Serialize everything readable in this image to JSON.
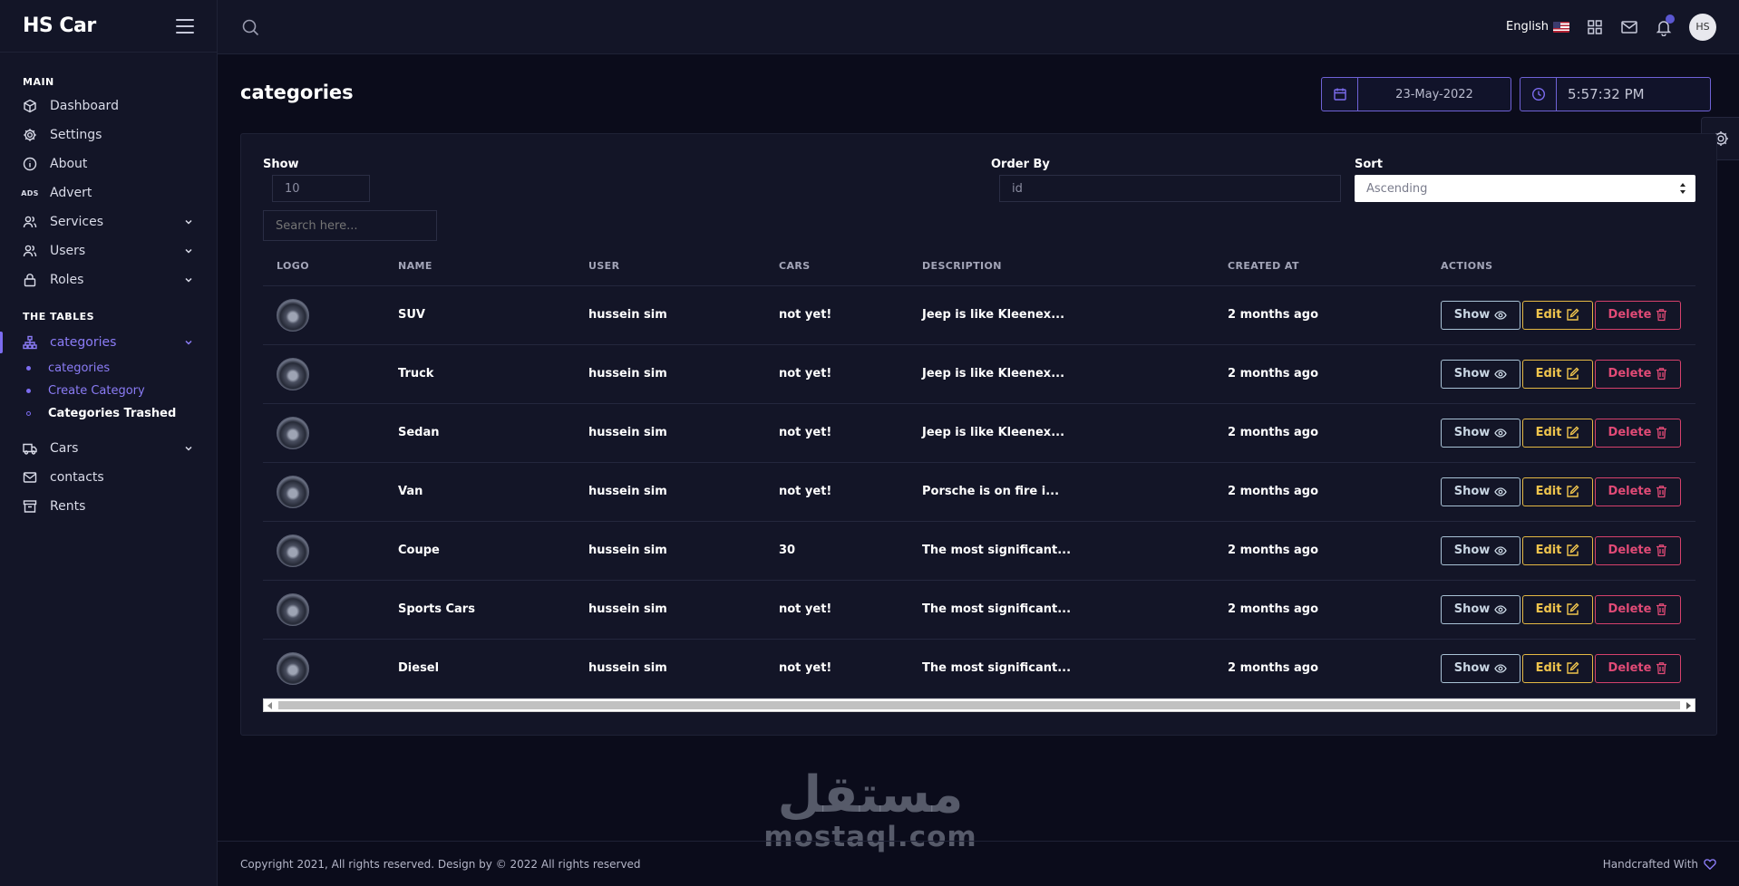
{
  "brand": "HS Car",
  "sidebar": {
    "main_heading": "MAIN",
    "tables_heading": "THE TABLES",
    "ads_tag": "ADS",
    "items": {
      "dashboard": "Dashboard",
      "settings": "Settings",
      "about": "About",
      "advert": "Advert",
      "services": "Services",
      "users": "Users",
      "roles": "Roles",
      "categories": "categories",
      "cars": "Cars",
      "contacts": "contacts",
      "rents": "Rents"
    },
    "categories_sub": {
      "list": "categories",
      "create": "Create Category",
      "trashed": "Categories Trashed"
    }
  },
  "header": {
    "language": "English",
    "avatar_initials": "HS"
  },
  "page": {
    "title": "categories",
    "date": "23-May-2022",
    "time": "5:57:32 PM"
  },
  "filters": {
    "show_label": "Show",
    "show_value": "10",
    "order_label": "Order By",
    "order_value": "id",
    "sort_label": "Sort",
    "sort_value": "Ascending",
    "search_placeholder": "Search here..."
  },
  "table": {
    "columns": [
      "LOGO",
      "NAME",
      "USER",
      "CARS",
      "DESCRIPTION",
      "CREATED AT",
      "ACTIONS"
    ],
    "actions": {
      "show": "Show",
      "edit": "Edit",
      "delete": "Delete"
    },
    "rows": [
      {
        "name": "SUV",
        "user": "hussein sim",
        "cars": "not yet!",
        "description": "Jeep is like Kleenex...",
        "created": "2 months ago"
      },
      {
        "name": "Truck",
        "user": "hussein sim",
        "cars": "not yet!",
        "description": "Jeep is like Kleenex...",
        "created": "2 months ago"
      },
      {
        "name": "Sedan",
        "user": "hussein sim",
        "cars": "not yet!",
        "description": "Jeep is like Kleenex...",
        "created": "2 months ago"
      },
      {
        "name": "Van",
        "user": "hussein sim",
        "cars": "not yet!",
        "description": "Porsche is on fire i...",
        "created": "2 months ago"
      },
      {
        "name": "Coupe",
        "user": "hussein sim",
        "cars": "30",
        "description": "The most significant...",
        "created": "2 months ago"
      },
      {
        "name": "Sports Cars",
        "user": "hussein sim",
        "cars": "not yet!",
        "description": "The most significant...",
        "created": "2 months ago"
      },
      {
        "name": "Diesel",
        "user": "hussein sim",
        "cars": "not yet!",
        "description": "The most significant...",
        "created": "2 months ago"
      }
    ]
  },
  "footer": {
    "copyright": "Copyright 2021, All rights reserved. Design by © 2022 All rights reserved",
    "handcrafted": "Handcrafted With"
  },
  "watermark": {
    "arabic": "مستقل",
    "latin": "mostaql.com"
  },
  "colors": {
    "accent": "#7c6cf0",
    "background": "#0b0c1b",
    "panel": "#131527",
    "show": "#a9c3d6",
    "edit": "#e5b944",
    "delete": "#d6416c"
  }
}
